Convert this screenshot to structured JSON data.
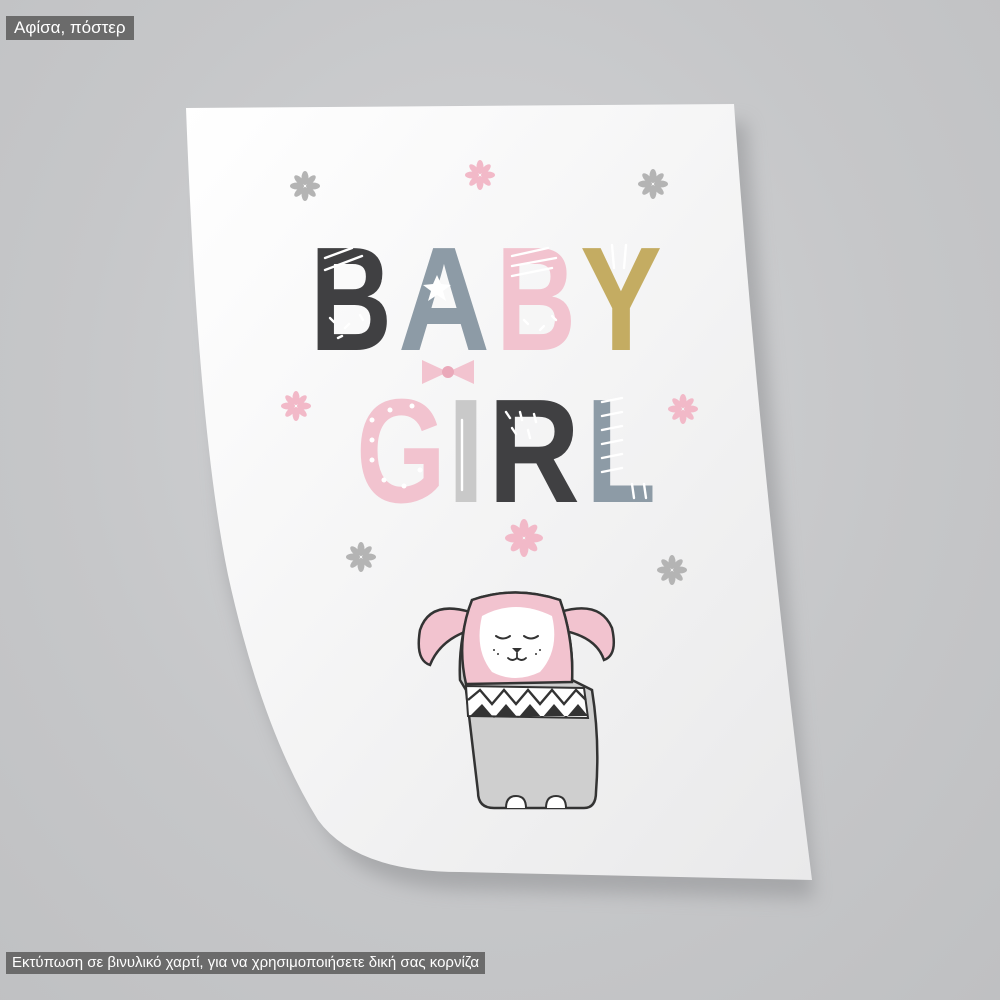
{
  "labels": {
    "top": "Αφίσα, πόστερ",
    "bottom": "Εκτύπωση σε βινυλικό χαρτί, για να χρησιμοποιήσετε δική σας κορνίζα"
  },
  "poster": {
    "word1": [
      "B",
      "A",
      "B",
      "Y"
    ],
    "word2": [
      "G",
      "I",
      "R",
      "L"
    ]
  },
  "colors": {
    "charcoal": "#404042",
    "slate": "#8d9ba6",
    "pink": "#f2c3cf",
    "ochre": "#c4ac62",
    "lightgray": "#c9c9c9"
  }
}
